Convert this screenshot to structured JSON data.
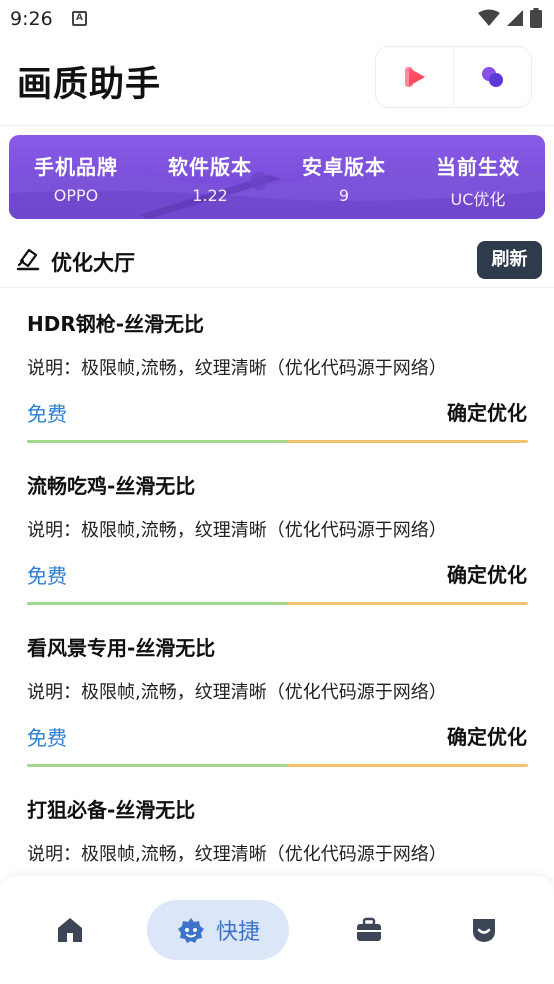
{
  "status_bar": {
    "time": "9:26",
    "notif_icon": "A"
  },
  "header": {
    "title": "画质助手"
  },
  "device_info": [
    {
      "label": "手机品牌",
      "value": "OPPO"
    },
    {
      "label": "软件版本",
      "value": "1.22"
    },
    {
      "label": "安卓版本",
      "value": "9"
    },
    {
      "label": "当前生效",
      "value": "UC优化"
    }
  ],
  "section": {
    "title": "优化大厅",
    "refresh_label": "刷新"
  },
  "options": [
    {
      "title": "HDR钢枪-丝滑无比",
      "desc": "说明：极限帧,流畅，纹理清晰（优化代码源于网络）",
      "price": "免费",
      "action": "确定优化"
    },
    {
      "title": "流畅吃鸡-丝滑无比",
      "desc": "说明：极限帧,流畅，纹理清晰（优化代码源于网络）",
      "price": "免费",
      "action": "确定优化"
    },
    {
      "title": "看风景专用-丝滑无比",
      "desc": "说明：极限帧,流畅，纹理清晰（优化代码源于网络）",
      "price": "免费",
      "action": "确定优化"
    },
    {
      "title": "打狙必备-丝滑无比",
      "desc": "说明：极限帧,流畅，纹理清晰（优化代码源于网络）",
      "price": "",
      "action": ""
    }
  ],
  "bottom_nav": {
    "quick_label": "快捷"
  },
  "colors": {
    "accent_blue": "#2d7fd0",
    "banner_purple": "#7a4edb",
    "refresh_bg": "#2f3a4c",
    "nav_active_bg": "#dbe6f8"
  }
}
